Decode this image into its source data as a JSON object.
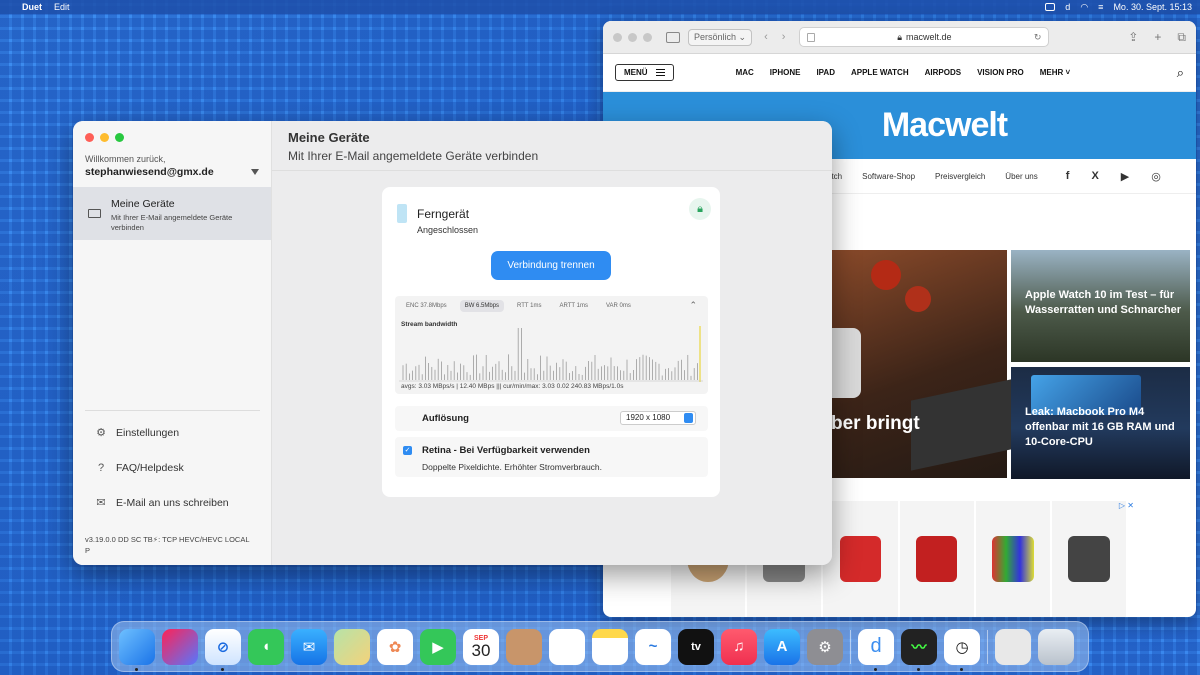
{
  "menubar": {
    "app": "Duet",
    "items": [
      "Edit"
    ],
    "clock": "Mo. 30. Sept.  15:13"
  },
  "safari": {
    "profile": "Persönlich",
    "url": "macwelt.de",
    "menu_label": "MENÜ",
    "nav": [
      "MAC",
      "IPHONE",
      "IPAD",
      "APPLE WATCH",
      "AIRPODS",
      "VISION PRO",
      "MEHR"
    ],
    "logo": "Macwelt",
    "subnav": [
      "atch",
      "Software-Shop",
      "Preisvergleich",
      "Über uns"
    ],
    "hero_title": "ber bringt",
    "card1": "Apple Watch 10 im Test – für Wasserratten und Schnarcher",
    "card2": "Leak: Macbook Pro M4 offenbar mit 16 GB RAM und 10-Core-CPU"
  },
  "duet": {
    "welcome": "Willkommen zurück,",
    "email": "stephanwiesend@gmx.de",
    "nav_title": "Meine Geräte",
    "nav_sub": "Mit Ihrer E-Mail angemeldete Geräte verbinden",
    "links": [
      "Einstellungen",
      "FAQ/Helpdesk",
      "E-Mail an uns schreiben"
    ],
    "version": "v3.19.0.0 DD SC TB⚡: TCP HEVC/HEVC LOCAL P",
    "header_title": "Meine Geräte",
    "header_sub": "Mit Ihrer E-Mail angemeldete Geräte verbinden",
    "device_name": "Ferngerät",
    "device_state": "Angeschlossen",
    "disconnect": "Verbindung trennen",
    "stats_tabs": [
      "ENC 37.8Mbps",
      "BW 6.5Mbps",
      "RTT 1ms",
      "ARTT 1ms",
      "VAR 0ms"
    ],
    "graph_label": "Stream bandwidth",
    "avgs": "avgs: 3.03 MBps/s | 12.40 MBps ||| cur/min/max: 3.03 0.02 240.83 MBps/1.0s",
    "resolution_label": "Auflösung",
    "resolution_value": "1920 x 1080",
    "retina_label": "Retina - Bei Verfügbarkeit verwenden",
    "retina_sub": "Doppelte Pixeldichte. Erhöhter Stromverbrauch."
  },
  "dock": {
    "calendar_month": "SEP",
    "calendar_day": "30",
    "tv": "tv"
  }
}
